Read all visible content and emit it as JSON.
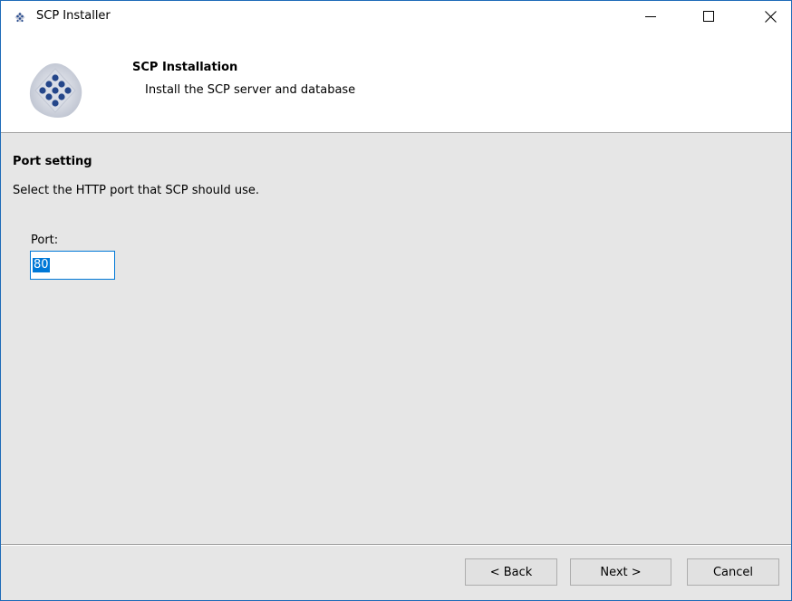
{
  "window": {
    "title": "SCP Installer",
    "icon": "scp-diamond-icon"
  },
  "title_controls": {
    "minimize_icon": "minimize-icon",
    "maximize_icon": "maximize-icon",
    "close_icon": "close-icon"
  },
  "header": {
    "title": "SCP Installation",
    "subtitle": "Install the SCP server and database",
    "logo_icon": "scp-logo-icon"
  },
  "content": {
    "section_title": "Port setting",
    "description": "Select the HTTP port that SCP should use.",
    "port_label": "Port:",
    "port_value": "80"
  },
  "footer": {
    "back_label": "< Back",
    "next_label": "Next >",
    "cancel_label": "Cancel"
  },
  "colors": {
    "accent": "#0078d7",
    "border": "#1e6bb8",
    "background": "#e6e6e6",
    "logo_blue": "#2a4d8f"
  }
}
